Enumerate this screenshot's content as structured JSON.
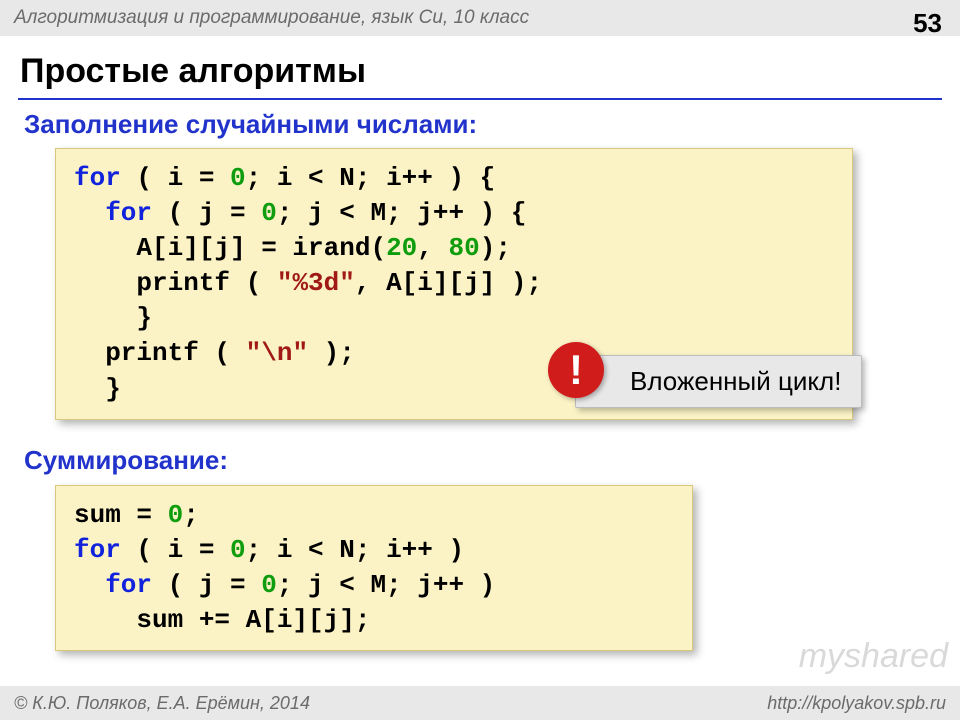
{
  "header": {
    "course": "Алгоритмизация и программирование, язык Си, 10 класс",
    "page": "53"
  },
  "title": "Простые алгоритмы",
  "section1": {
    "heading": "Заполнение случайными числами:",
    "code": {
      "l1a": "for",
      "l1b": " ( i = ",
      "l1c": "0",
      "l1d": "; i < N; i++ ) {",
      "l2a": "  for",
      "l2b": " ( j = ",
      "l2c": "0",
      "l2d": "; j < M; j++ ) {",
      "l3a": "    A[i][j] = irand(",
      "l3b": "20",
      "l3c": ", ",
      "l3d": "80",
      "l3e": ");",
      "l4a": "    printf ( ",
      "l4b": "\"%3d\"",
      "l4c": ", A[i][j] );",
      "l5": "    }",
      "l6a": "  printf ( ",
      "l6b": "\"\\n\"",
      "l6c": " );",
      "l7": "  }"
    }
  },
  "callout": {
    "bang": "!",
    "text": "Вложенный цикл!"
  },
  "section2": {
    "heading": "Суммирование:",
    "code": {
      "l1a": "sum = ",
      "l1b": "0",
      "l1c": ";",
      "l2a": "for",
      "l2b": " ( i = ",
      "l2c": "0",
      "l2d": "; i < N; i++ )",
      "l3a": "  for",
      "l3b": " ( j = ",
      "l3c": "0",
      "l3d": "; j < M; j++ )",
      "l4": "    sum += A[i][j];"
    }
  },
  "footer": {
    "left_prefix": "© ",
    "left": "К.Ю. Поляков, Е.А. Ерёмин, 2014",
    "right": "http://kpolyakov.spb.ru"
  },
  "watermark": "myshared"
}
